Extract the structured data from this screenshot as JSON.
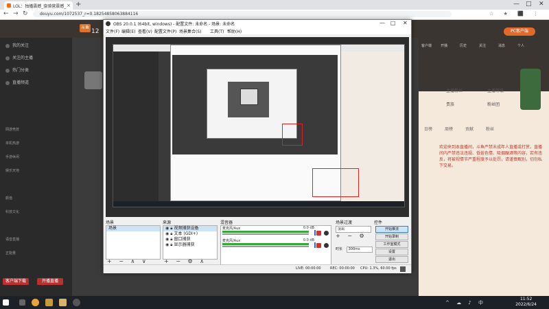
{
  "browser": {
    "tab_title": "LOL：独播震撼_骁骑营震撼_斗鱼直播",
    "tab_close": "×",
    "new_tab": "+",
    "url": "douyu.com/1072537_r=0.18254858063884116",
    "window_controls": [
      "—",
      "□",
      "✕"
    ]
  },
  "douyu": {
    "logo": "斗鱼",
    "head_stat": "12",
    "sidebar_items": [
      "我的关注",
      "关注的主播",
      "热门分类",
      "直播频道"
    ],
    "sidebar_grid": [
      "网游竞技",
      "单机热游",
      "手游休闲",
      "娱乐天地",
      "颜值",
      "科技文化",
      "语音直播",
      "正能量"
    ],
    "sidebar_buttons": [
      "客户端下载",
      "开播直播"
    ],
    "top_right_icons": [
      "客户端",
      "开播",
      "历史",
      "关注",
      "消息",
      "个人"
    ],
    "pc_button": "PC客户端",
    "right_rows": [
      "主播粉丝",
      "主播等级",
      "贵族",
      "粉丝团"
    ],
    "right_tabs": [
      "日榜",
      "周榜",
      "贡献",
      "粉丝"
    ],
    "chat_lines": [
      "欢迎来到本直播间，斗鱼严禁未成年人直播或打赏，直播间内严禁违法违规、低俗色情、吸烟酗酒等内容，若有违反，将被视情节严重程度予以处罚，请谨慎甄别，切勿私下交易。"
    ]
  },
  "obs": {
    "title": "OBS 20.0.1 (64bit, windows) - 配置文件: 未命名 - 场景: 未命名",
    "window_controls": [
      "—",
      "□",
      "✕"
    ],
    "menu": [
      "文件(F)",
      "编辑(E)",
      "查看(V)",
      "配置文件(P)",
      "场景集合(S)",
      "工具(T)",
      "帮助(H)"
    ],
    "scenes": {
      "title": "场景",
      "items": [
        "场景"
      ],
      "tools": "+ − ∧ ∨"
    },
    "sources": {
      "title": "来源",
      "items": [
        "视频捕获设备",
        "文本 (GDI+)",
        "窗口捕获",
        "显示器捕获"
      ],
      "tools": "+ − ⚙ ∧ ∨"
    },
    "mixer": {
      "title": "混音器",
      "channels": [
        {
          "name": "麦克风/Aux",
          "db": "0.0 dB"
        },
        {
          "name": "麦克风/Aux",
          "db": "0.0 dB"
        }
      ]
    },
    "transitions": {
      "title": "场景过渡",
      "selected": "淡出",
      "tools": "+ − ⚙",
      "duration_label": "时长",
      "duration_value": "300ms"
    },
    "controls": {
      "title": "控件",
      "buttons": [
        "开始推流",
        "开始录制",
        "工作室模式",
        "设置",
        "退出"
      ],
      "active_index": 0
    },
    "status": {
      "live": "LIVE: 00:00:00",
      "rec": "REC: 00:00:00",
      "cpu": "CPU: 1.3%, 60.00 fps"
    }
  },
  "taskbar": {
    "time": "11:52",
    "date": "2022/6/24",
    "tray": "^ ☁ ♪ 中"
  }
}
